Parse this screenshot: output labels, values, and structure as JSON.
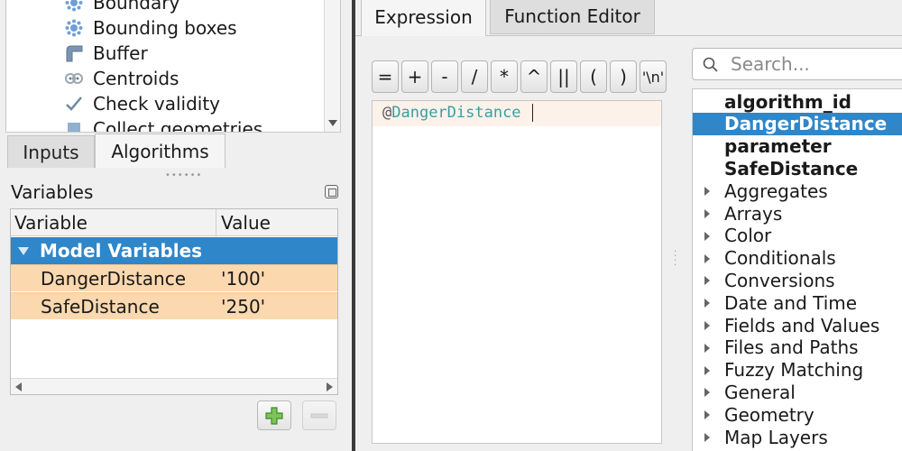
{
  "algorithms_list": {
    "items": [
      {
        "label": "Boundary",
        "icon": "boundary-icon"
      },
      {
        "label": "Bounding boxes",
        "icon": "bounding-boxes-icon"
      },
      {
        "label": "Buffer",
        "icon": "buffer-icon"
      },
      {
        "label": "Centroids",
        "icon": "centroids-icon"
      },
      {
        "label": "Check validity",
        "icon": "check-icon"
      },
      {
        "label": "Collect geometries",
        "icon": "collect-icon"
      }
    ]
  },
  "left_tabs": {
    "inputs": "Inputs",
    "algorithms": "Algorithms"
  },
  "variables": {
    "title": "Variables",
    "columns": {
      "variable": "Variable",
      "value": "Value"
    },
    "group": "Model Variables",
    "rows": [
      {
        "name": "DangerDistance",
        "value": "'100'"
      },
      {
        "name": "SafeDistance",
        "value": "'250'"
      }
    ]
  },
  "right_tabs": {
    "expression": "Expression",
    "function_editor": "Function Editor"
  },
  "operators": [
    "=",
    "+",
    "-",
    "/",
    "*",
    "^",
    "||",
    "(",
    ")",
    "'\\n'"
  ],
  "editor": {
    "prefix": "@",
    "variable": "DangerDistance"
  },
  "search": {
    "placeholder": "Search..."
  },
  "function_tree": {
    "items": [
      {
        "label": "algorithm_id",
        "bold": true,
        "expandable": false,
        "selected": false
      },
      {
        "label": "DangerDistance",
        "bold": true,
        "expandable": false,
        "selected": true
      },
      {
        "label": "parameter",
        "bold": true,
        "expandable": false,
        "selected": false
      },
      {
        "label": "SafeDistance",
        "bold": true,
        "expandable": false,
        "selected": false
      },
      {
        "label": "Aggregates",
        "bold": false,
        "expandable": true,
        "selected": false
      },
      {
        "label": "Arrays",
        "bold": false,
        "expandable": true,
        "selected": false
      },
      {
        "label": "Color",
        "bold": false,
        "expandable": true,
        "selected": false
      },
      {
        "label": "Conditionals",
        "bold": false,
        "expandable": true,
        "selected": false
      },
      {
        "label": "Conversions",
        "bold": false,
        "expandable": true,
        "selected": false
      },
      {
        "label": "Date and Time",
        "bold": false,
        "expandable": true,
        "selected": false
      },
      {
        "label": "Fields and Values",
        "bold": false,
        "expandable": true,
        "selected": false
      },
      {
        "label": "Files and Paths",
        "bold": false,
        "expandable": true,
        "selected": false
      },
      {
        "label": "Fuzzy Matching",
        "bold": false,
        "expandable": true,
        "selected": false
      },
      {
        "label": "General",
        "bold": false,
        "expandable": true,
        "selected": false
      },
      {
        "label": "Geometry",
        "bold": false,
        "expandable": true,
        "selected": false
      },
      {
        "label": "Map Layers",
        "bold": false,
        "expandable": true,
        "selected": false
      }
    ]
  },
  "colors": {
    "selection": "#2f86c9",
    "variable_row": "#fbd8ae",
    "variable_text": "#3a9ea3"
  }
}
